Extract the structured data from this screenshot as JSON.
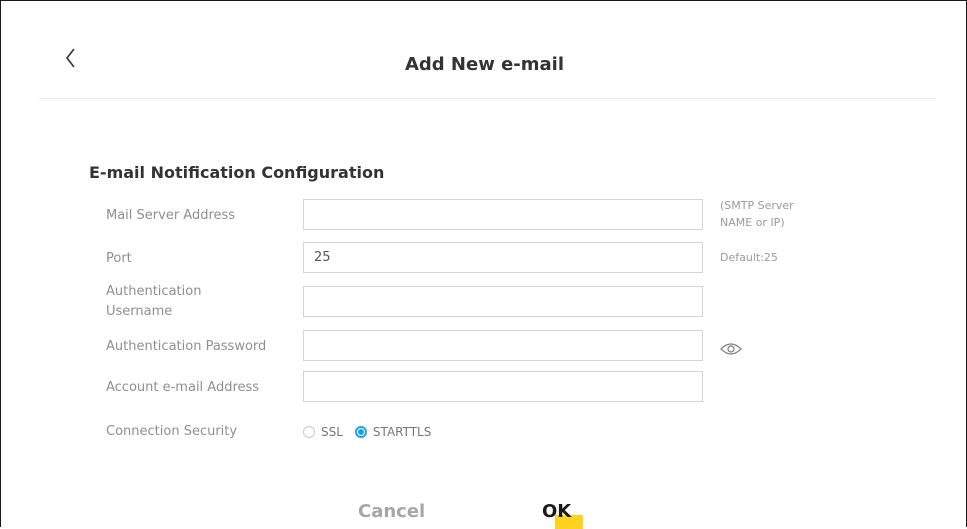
{
  "dialog": {
    "title": "Add New e-mail",
    "back_icon": "chevron-left-icon"
  },
  "section": {
    "title": "E-mail Notification Configuration"
  },
  "fields": {
    "mail_server": {
      "label": "Mail Server Address",
      "value": "",
      "hint_line1": "(SMTP Server",
      "hint_line2": "NAME or IP)"
    },
    "port": {
      "label": "Port",
      "value": "25",
      "hint": "Default:25"
    },
    "auth_username": {
      "label_line1": "Authentication",
      "label_line2": "Username",
      "value": ""
    },
    "auth_password": {
      "label": "Authentication Password",
      "value": "",
      "toggle_icon": "eye-icon"
    },
    "account_email": {
      "label": "Account e-mail Address",
      "value": ""
    }
  },
  "connection_security": {
    "label": "Connection Security",
    "options": [
      {
        "label": "SSL",
        "checked": false
      },
      {
        "label": "STARTTLS",
        "checked": true
      }
    ]
  },
  "actions": {
    "cancel_label": "Cancel",
    "ok_label": "OK"
  },
  "colors": {
    "accent": "#1ba1ea",
    "ok_highlight": "#ffd21f",
    "label_text": "#8f8f8f"
  }
}
